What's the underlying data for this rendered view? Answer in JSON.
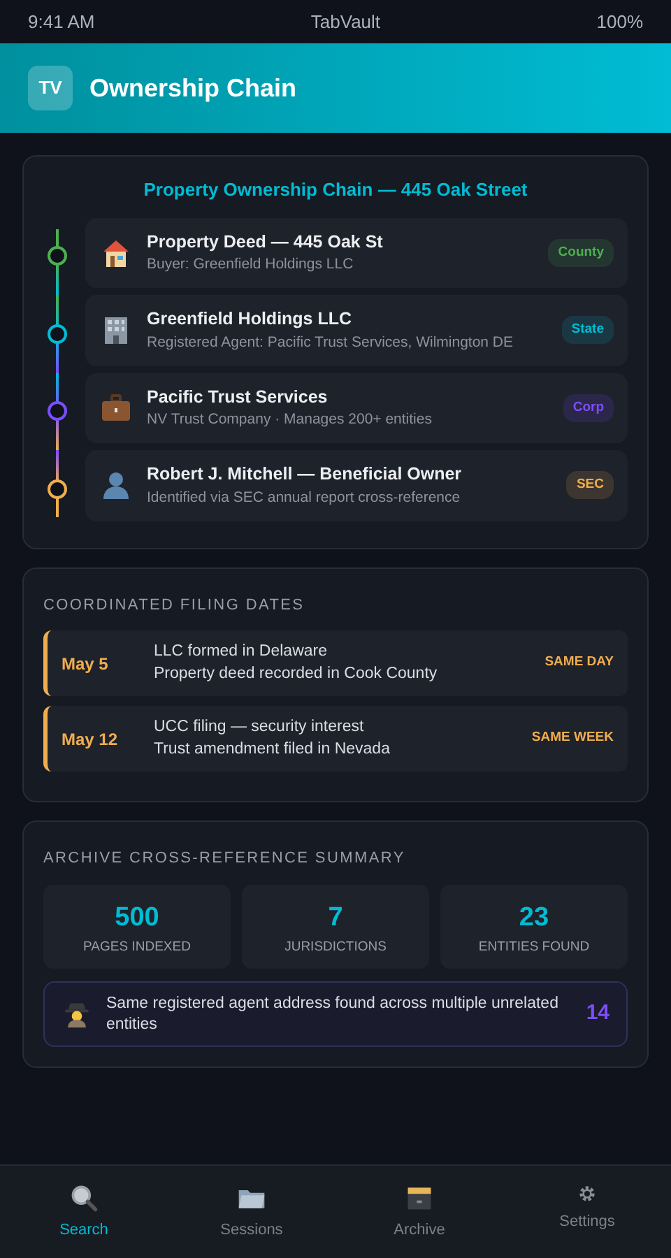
{
  "status_bar": {
    "time": "9:41 AM",
    "carrier": "TabVault",
    "battery": "100%"
  },
  "header": {
    "logo": "TV",
    "title": "Ownership Chain"
  },
  "chain": {
    "title": "Property Ownership Chain — 445 Oak Street",
    "items": [
      {
        "title": "Property Deed — 445 Oak St",
        "subtitle": "Buyer: Greenfield Holdings LLC",
        "tag": "County",
        "color": "#4caf50"
      },
      {
        "title": "Greenfield Holdings LLC",
        "subtitle": "Registered Agent: Pacific Trust Services, Wilmington DE",
        "tag": "State",
        "color": "#00bcd4"
      },
      {
        "title": "Pacific Trust Services",
        "subtitle": "NV Trust Company · Manages 200+ entities",
        "tag": "Corp",
        "color": "#7c4dff"
      },
      {
        "title": "Robert J. Mitchell — Beneficial Owner",
        "subtitle": "Identified via SEC annual report cross-reference",
        "tag": "SEC",
        "color": "#f0ad4e"
      }
    ]
  },
  "filings": {
    "title": "COORDINATED FILING DATES",
    "items": [
      {
        "date": "May 5",
        "lines": [
          "LLC formed in Delaware",
          "Property deed recorded in Cook County"
        ],
        "tag": "SAME DAY"
      },
      {
        "date": "May 12",
        "lines": [
          "UCC filing — security interest",
          "Trust amendment filed in Nevada"
        ],
        "tag": "SAME WEEK"
      }
    ]
  },
  "summary": {
    "title": "ARCHIVE CROSS-REFERENCE SUMMARY",
    "stats": [
      {
        "value": "500",
        "label": "PAGES INDEXED"
      },
      {
        "value": "7",
        "label": "JURISDICTIONS"
      },
      {
        "value": "23",
        "label": "ENTITIES FOUND"
      }
    ],
    "alert": {
      "text": "Same registered agent address found across multiple unrelated entities",
      "count": "14"
    }
  },
  "tab_bar": [
    {
      "label": "Search",
      "selected": true
    },
    {
      "label": "Sessions",
      "selected": false
    },
    {
      "label": "Archive",
      "selected": false
    },
    {
      "label": "Settings",
      "selected": false
    }
  ]
}
